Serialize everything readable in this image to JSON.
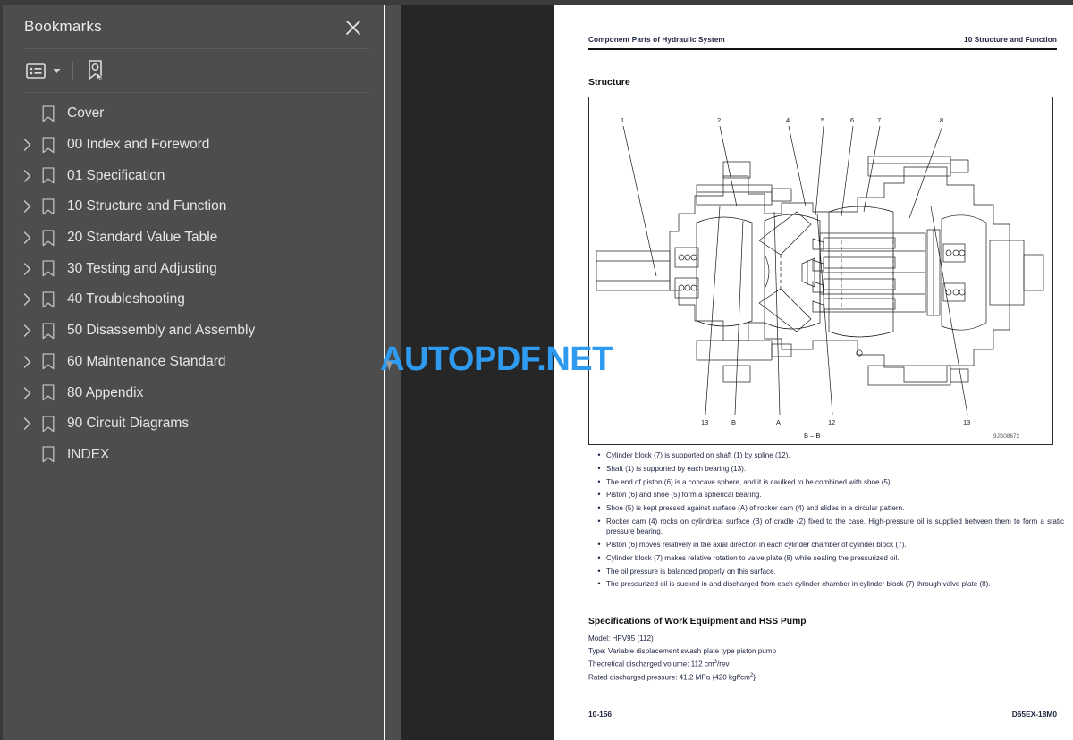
{
  "sidebar": {
    "title": "Bookmarks",
    "close_icon": "close-icon",
    "toolbar": {
      "options_icon": "bookmark-options-list-icon",
      "caret_icon": "chevron-down-icon",
      "new_bookmark_icon": "new-bookmark-icon"
    },
    "items": [
      {
        "label": "Cover",
        "expandable": false
      },
      {
        "label": "00 Index and Foreword",
        "expandable": true
      },
      {
        "label": "01 Specification",
        "expandable": true
      },
      {
        "label": "10 Structure and Function",
        "expandable": true
      },
      {
        "label": "20 Standard Value Table",
        "expandable": true
      },
      {
        "label": "30 Testing and Adjusting",
        "expandable": true
      },
      {
        "label": "40 Troubleshooting",
        "expandable": true
      },
      {
        "label": "50 Disassembly and Assembly",
        "expandable": true
      },
      {
        "label": "60 Maintenance Standard",
        "expandable": true
      },
      {
        "label": "80 Appendix",
        "expandable": true
      },
      {
        "label": "90 Circuit Diagrams",
        "expandable": true
      },
      {
        "label": "INDEX",
        "expandable": false
      }
    ]
  },
  "watermark": {
    "text": "AUTOPDF.NET",
    "color": "#2e9bf0"
  },
  "page": {
    "header_left": "Component Parts of Hydraulic System",
    "header_right": "10 Structure and Function",
    "section_title": "Structure",
    "figure": {
      "caption": "B - B",
      "drawing_number": "9JS08672",
      "callouts_top": [
        "1",
        "2",
        "4",
        "5",
        "6",
        "7",
        "8"
      ],
      "callouts_bottom": [
        "13",
        "B",
        "A",
        "12",
        "13"
      ]
    },
    "bullets": [
      "Cylinder block (7) is supported on shaft (1) by spline (12).",
      "Shaft (1) is supported by each bearing (13).",
      "The end of piston (6) is a concave sphere, and it is caulked to be combined with shoe (5).",
      "Piston (6) and shoe (5) form a spherical bearing.",
      "Shoe (5) is kept pressed against surface (A) of rocker cam (4) and slides in a circular pattern.",
      "Rocker cam (4) rocks on cylindrical surface (B) of cradle (2) fixed to the case. High-pressure oil is supplied between them to form a static pressure bearing.",
      "Piston (6) moves relatively in the axial direction in each cylinder chamber of cylinder block (7).",
      "Cylinder block (7) makes relative rotation to valve plate (8) while sealing the pressurized oil.",
      "The oil pressure is balanced properly on this surface.",
      "The pressurized oil is sucked in and discharged from each cylinder chamber in cylinder block (7) through valve plate (8)."
    ],
    "spec_title": "Specifications of Work Equipment and HSS Pump",
    "spec_lines": [
      {
        "text": "Model: HPV95 (112)"
      },
      {
        "text": "Type: Variable displacement swash plate type piston pump"
      },
      {
        "text": "Theoretical discharged volume: 112 cm",
        "sup": "3",
        "after": "/rev"
      },
      {
        "text": "Rated discharged pressure: 41.2 MPa {420 kgf/cm",
        "sup": "2",
        "after": "}"
      }
    ],
    "footer_left": "10-156",
    "footer_right": "D65EX-18M0"
  }
}
